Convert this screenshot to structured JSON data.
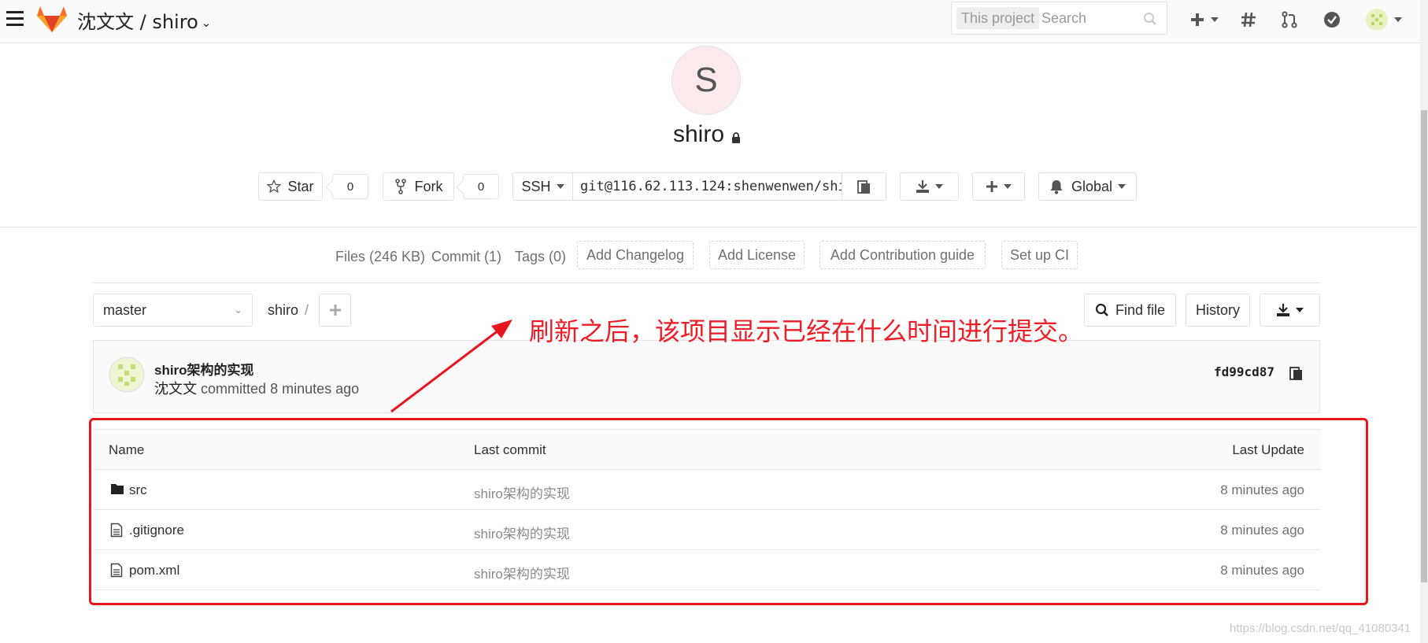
{
  "navbar": {
    "title": "沈文文 / shiro",
    "search_scope": "This project",
    "search_placeholder": "Search"
  },
  "project": {
    "avatar_letter": "S",
    "name": "shiro",
    "star_label": "Star",
    "star_count": "0",
    "fork_label": "Fork",
    "fork_count": "0",
    "protocol": "SSH",
    "clone_url": "git@116.62.113.124:shenwenwen/shi",
    "notification_label": "Global"
  },
  "stats": {
    "files": "Files (246 KB)",
    "commits": "Commit (1)",
    "tags": "Tags (0)",
    "add_changelog": "Add Changelog",
    "add_license": "Add License",
    "add_contribution": "Add Contribution guide",
    "setup_ci": "Set up CI"
  },
  "tree": {
    "branch": "master",
    "breadcrumb_root": "shiro",
    "breadcrumb_sep": "/",
    "find_file": "Find file",
    "history": "History"
  },
  "last_commit": {
    "title": "shiro架构的实现",
    "author": "沈文文",
    "action": "committed",
    "time": "8 minutes ago",
    "sha": "fd99cd87"
  },
  "table": {
    "headers": {
      "name": "Name",
      "last_commit": "Last commit",
      "last_update": "Last Update"
    },
    "rows": [
      {
        "name": "src",
        "icon": "folder-icon",
        "last_commit": "shiro架构的实现",
        "last_update": "8 minutes ago"
      },
      {
        "name": ".gitignore",
        "icon": "file-icon",
        "last_commit": "shiro架构的实现",
        "last_update": "8 minutes ago"
      },
      {
        "name": "pom.xml",
        "icon": "file-icon",
        "last_commit": "shiro架构的实现",
        "last_update": "8 minutes ago"
      }
    ]
  },
  "annotation": {
    "text": "刷新之后，该项目显示已经在什么时间进行提交。",
    "color": "#ee1c25"
  },
  "watermark": "https://blog.csdn.net/qq_41080341",
  "colors": {
    "accent_orange": "#fc6d26",
    "annotation_red": "#e8141e"
  }
}
